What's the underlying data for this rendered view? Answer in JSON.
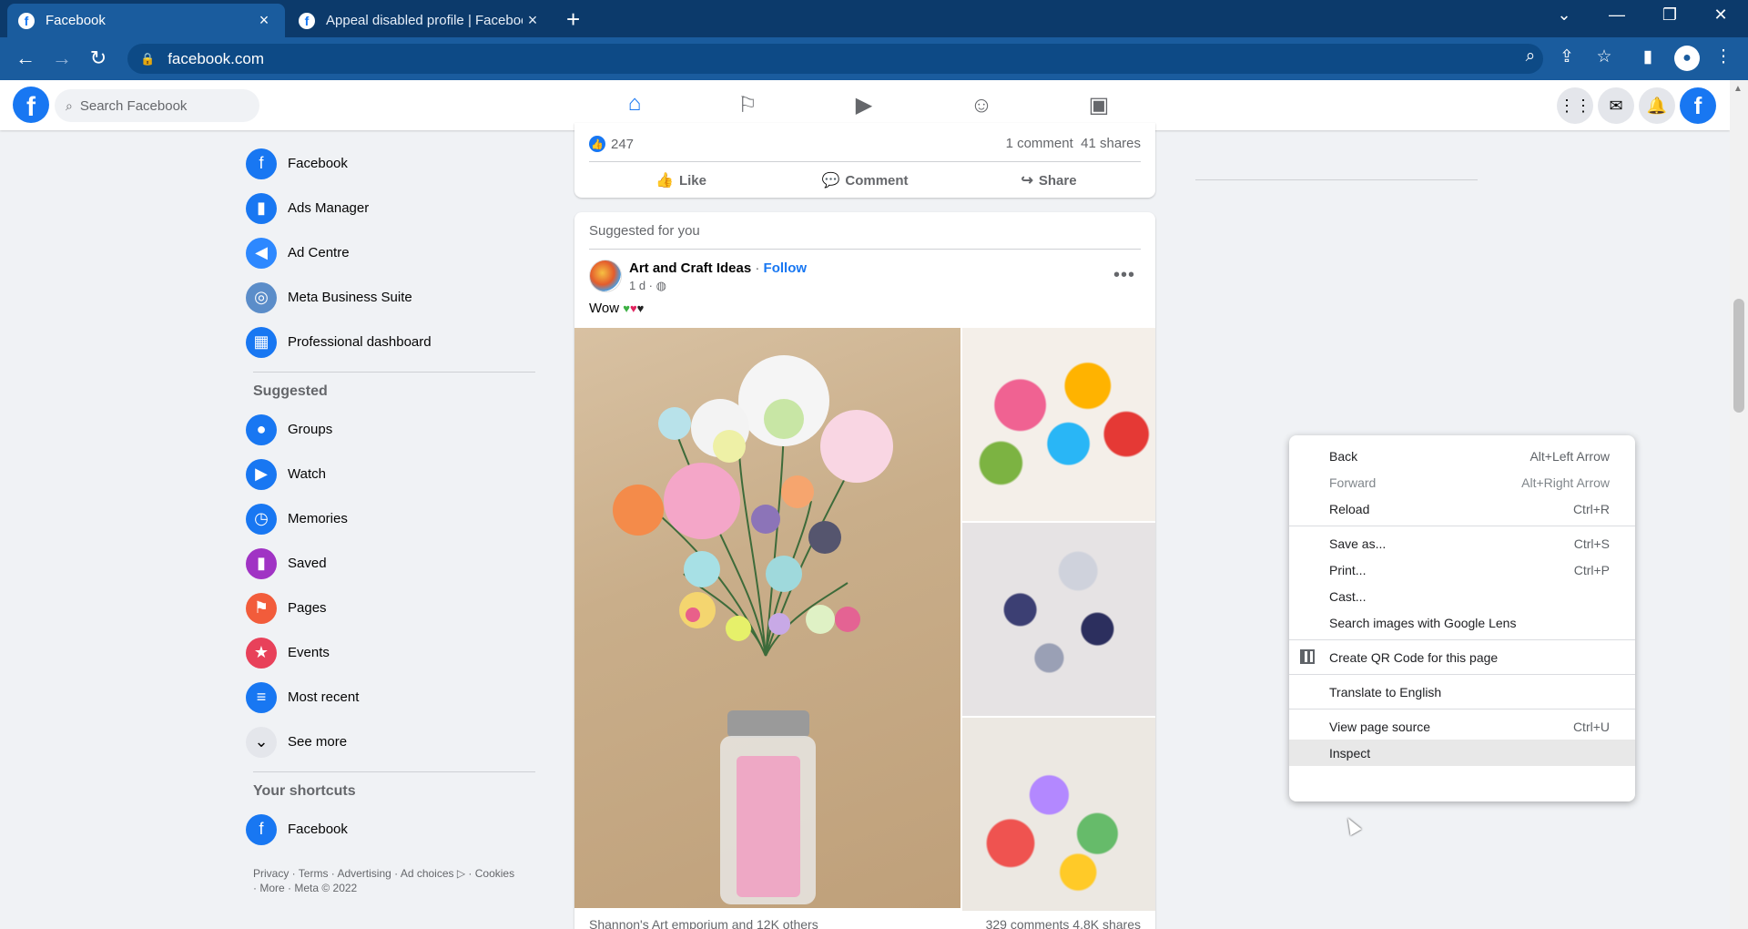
{
  "browser": {
    "tabs": [
      {
        "title": "Facebook",
        "active": true
      },
      {
        "title": "Appeal disabled profile | Faceboo",
        "active": false
      }
    ],
    "new_tab_icon": "+",
    "address": "facebook.com",
    "window_controls": {
      "dropdown": "⌄",
      "minimize": "—",
      "restore": "❐",
      "close": "✕"
    }
  },
  "fb_header": {
    "logo": "f",
    "search_placeholder": "Search Facebook",
    "nav": [
      "home-icon",
      "pages-flag-icon",
      "watch-icon",
      "groups-icon",
      "gaming-icon"
    ],
    "right_icons": [
      "menu-grid-icon",
      "messenger-icon",
      "notifications-bell-icon",
      "profile-icon"
    ]
  },
  "sidebar": {
    "top_items": [
      {
        "label": "Facebook",
        "icon": "facebook-icon",
        "color": "#1877f2",
        "glyph": "f"
      },
      {
        "label": "Ads Manager",
        "icon": "ads-manager-icon",
        "color": "#1877f2",
        "glyph": "▮"
      },
      {
        "label": "Ad Centre",
        "icon": "ad-centre-icon",
        "color": "#2d88ff",
        "glyph": "◀"
      },
      {
        "label": "Meta Business Suite",
        "icon": "business-suite-icon",
        "color": "#5b8dc9",
        "glyph": "◎"
      },
      {
        "label": "Professional dashboard",
        "icon": "dashboard-icon",
        "color": "#1877f2",
        "glyph": "▦"
      }
    ],
    "suggested_heading": "Suggested",
    "suggested_items": [
      {
        "label": "Groups",
        "icon": "groups-icon",
        "color": "#1877f2",
        "glyph": "●"
      },
      {
        "label": "Watch",
        "icon": "watch-icon",
        "color": "#1877f2",
        "glyph": "▶"
      },
      {
        "label": "Memories",
        "icon": "memories-icon",
        "color": "#1877f2",
        "glyph": "◷"
      },
      {
        "label": "Saved",
        "icon": "saved-icon",
        "color": "#a033c4",
        "glyph": "▮"
      },
      {
        "label": "Pages",
        "icon": "pages-icon",
        "color": "#f25c3b",
        "glyph": "⚑"
      },
      {
        "label": "Events",
        "icon": "events-icon",
        "color": "#e8415a",
        "glyph": "★"
      },
      {
        "label": "Most recent",
        "icon": "most-recent-icon",
        "color": "#1877f2",
        "glyph": "≡"
      },
      {
        "label": "See more",
        "icon": "chevron-down-icon",
        "color": "#e4e6eb",
        "glyph": "⌄"
      }
    ],
    "shortcuts_heading": "Your shortcuts",
    "shortcuts": [
      {
        "label": "Facebook",
        "icon": "facebook-icon",
        "color": "#1877f2",
        "glyph": "f"
      }
    ],
    "footer": "Privacy · Terms · Advertising · Ad choices ▷ · Cookies · More · Meta © 2022"
  },
  "post1": {
    "like_count": "247",
    "comments": "1 comment",
    "shares": "41 shares",
    "actions": {
      "like": "Like",
      "comment": "Comment",
      "share": "Share"
    }
  },
  "post2": {
    "suggested_label": "Suggested for you",
    "page_name": "Art and Craft Ideas",
    "separator": " · ",
    "follow": "Follow",
    "time": "1 d · ",
    "text": "Wow ",
    "hearts": [
      "💚",
      "❤️",
      "🖤"
    ],
    "hearts_colors": [
      "#3cb043",
      "#e0245e",
      "#222222"
    ],
    "bottom_left": "Shannon's Art emporium and 12K others",
    "bottom_right": "329 comments  4.8K shares"
  },
  "context_menu": {
    "items": [
      {
        "label": "Back",
        "shortcut": "Alt+Left Arrow",
        "disabled": false
      },
      {
        "label": "Forward",
        "shortcut": "Alt+Right Arrow",
        "disabled": true
      },
      {
        "label": "Reload",
        "shortcut": "Ctrl+R",
        "disabled": false
      },
      {
        "sep": true
      },
      {
        "label": "Save as...",
        "shortcut": "Ctrl+S",
        "disabled": false
      },
      {
        "label": "Print...",
        "shortcut": "Ctrl+P",
        "disabled": false
      },
      {
        "label": "Cast...",
        "shortcut": "",
        "disabled": false
      },
      {
        "label": "Search images with Google Lens",
        "shortcut": "",
        "disabled": false
      },
      {
        "sep": true
      },
      {
        "label": "Create QR Code for this page",
        "shortcut": "",
        "disabled": false,
        "icon": "qr-code-icon"
      },
      {
        "sep": true
      },
      {
        "label": "Translate to English",
        "shortcut": "",
        "disabled": false
      },
      {
        "sep": true
      },
      {
        "label": "View page source",
        "shortcut": "Ctrl+U",
        "disabled": false
      },
      {
        "label": "Inspect",
        "shortcut": "",
        "disabled": false,
        "highlighted": true
      }
    ]
  }
}
